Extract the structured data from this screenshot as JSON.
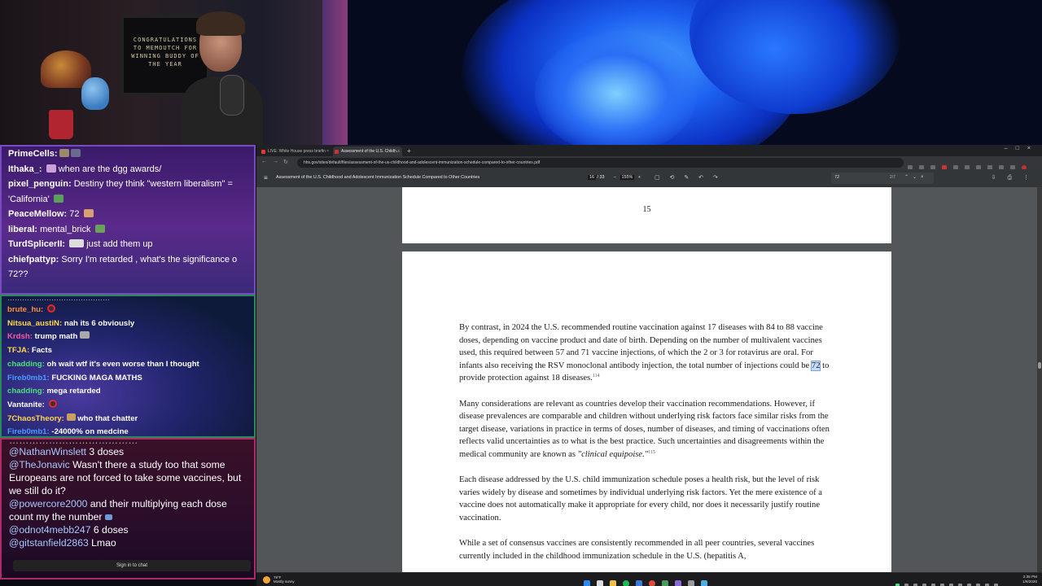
{
  "webcam": {
    "frame_text": "CONGRATULATIONS TO MEMOUTCH FOR WINNING BUDDY OF THE YEAR"
  },
  "chat_top": {
    "messages": [
      {
        "user": "PrimeCells:",
        "text": ""
      },
      {
        "user": "Ithaka_:",
        "text": "when are the dgg awards/"
      },
      {
        "user": "pixel_penguin:",
        "text": "Destiny they think \"western liberalism\" ="
      },
      {
        "user": "",
        "text": "'California'"
      },
      {
        "user": "PeaceMellow:",
        "text": "72"
      },
      {
        "user": "liberal:",
        "text": "mental_brick"
      },
      {
        "user": "TurdSplicerII:",
        "text": "just add them up"
      },
      {
        "user": "chiefpattyp:",
        "text": "Sorry I'm retarded , what's the significance o"
      },
      {
        "user": "",
        "text": "72??"
      }
    ]
  },
  "chat_mid": {
    "messages": [
      {
        "user": "brute_hu:",
        "text": "",
        "color": "#ff8c3a"
      },
      {
        "user": "Nitsua_austiN:",
        "text": "nah its 6 obviously",
        "color": "#ffd84a"
      },
      {
        "user": "Krdsh:",
        "text": "trump math",
        "color": "#ff5aa0"
      },
      {
        "user": "TFJA:",
        "text": "Facts",
        "color": "#ffd84a"
      },
      {
        "user": "chadding:",
        "text": "oh wait wtf it's even worse than I thought",
        "color": "#4ae07a"
      },
      {
        "user": "Fireb0mb1:",
        "text": "FUCKING MAGA MATHS",
        "color": "#4a9aff"
      },
      {
        "user": "chadding:",
        "text": "mega retarded",
        "color": "#4ae07a"
      },
      {
        "user": "Vantanite:",
        "text": "",
        "color": "#ffffff"
      },
      {
        "user": "7ChaosTheory:",
        "text": "who that chatter",
        "color": "#ffd84a"
      },
      {
        "user": "Fireb0mb1:",
        "text": "-24000% on medcine",
        "color": "#4a9aff"
      }
    ]
  },
  "chat_bottom": {
    "messages": [
      {
        "user": "@NathanWinslett",
        "text": "3 doses"
      },
      {
        "user": "@TheJonavic",
        "text": "Wasn't there a study too that some Europeans are not forced to take some vaccines, but we still do it?"
      },
      {
        "user": "@powercore2000",
        "text": "and their multiplying each dose count my the number"
      },
      {
        "user": "@odnot4mebb247",
        "text": "6 doses"
      },
      {
        "user": "@gitstanfield2863",
        "text": "Lmao"
      }
    ],
    "signin_label": "Sign in to chat"
  },
  "browser": {
    "tabs": [
      {
        "label": "LIVE: White House press briefin",
        "fav_color": "#e33"
      },
      {
        "label": "Assessment of the U.S. Childh...",
        "fav_color": "#c33"
      }
    ],
    "url": "hhs.gov/sites/default/files/assessment-of-the-us-childhood-and-adolescent-immunization-schedule-compared-to-other-countries.pdf",
    "pdf_title": "Assessment of the U.S. Childhood and Adolescent Immunization Schedule Compared to Other Countries",
    "page_current": "16",
    "page_total": "/ 33",
    "zoom": "155%",
    "find_query": "72",
    "find_count": "2/7"
  },
  "pdf": {
    "prev_page_number": "15",
    "paragraphs": [
      {
        "before": "By contrast, in 2024 the U.S. recommended routine vaccination against 17 diseases with 84 to 88 vaccine doses, depending on vaccine product and date of birth. Depending on the number of multivalent vaccines used, this required between 57 and 71 vaccine injections, of which the 2 or 3 for rotavirus are oral. For infants also receiving the RSV monoclonal antibody injection, the total number of injections could be ",
        "highlight": "72",
        "after": " to provide protection against 18 diseases.",
        "sup": "114"
      },
      {
        "before": "Many considerations are relevant as countries develop their vaccination recommendations. However, if disease prevalences are comparable and children without underlying risk factors face similar risks from the target disease, variations in practice in terms of doses, number of diseases, and timing of vaccinations often reflects valid uncertainties as to what is the best practice. Such uncertainties and disagreements within the medical community are known as ",
        "italic": "\"clinical equipoise.\"",
        "sup": "115"
      },
      {
        "before": "Each disease addressed by the U.S. child immunization schedule poses a health risk, but the level of risk varies widely by disease and sometimes by individual underlying risk factors. Yet the mere existence of a vaccine does not automatically make it appropriate for every child, nor does it necessarily justify routine vaccination."
      },
      {
        "before": "While a set of consensus vaccines are consistently recommended in all peer countries, several vaccines currently included in the childhood immunization schedule in the U.S. (hepatitis A,"
      }
    ]
  },
  "taskbar": {
    "weather_temp": "79°F",
    "weather_desc": "Mostly sunny",
    "time": "2:35 PM",
    "date": "1/8/2026"
  }
}
